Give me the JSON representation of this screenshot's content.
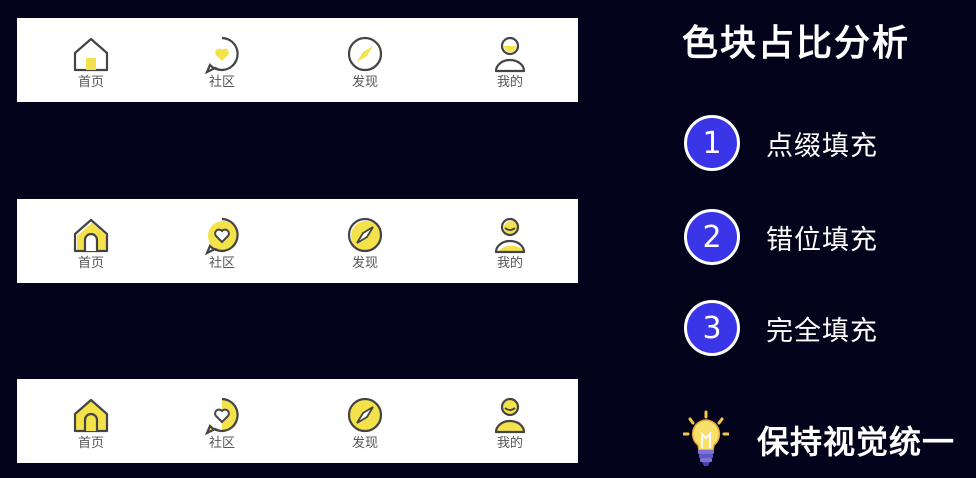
{
  "title": "色块占比分析",
  "tabs": [
    "首页",
    "社区",
    "发现",
    "我的"
  ],
  "items": [
    {
      "num": "1",
      "text": "点缀填充"
    },
    {
      "num": "2",
      "text": "错位填充"
    },
    {
      "num": "3",
      "text": "完全填充"
    }
  ],
  "tip": {
    "icon": "lightbulb-icon",
    "text": "保持视觉统一"
  },
  "colors": {
    "background": "#04031c",
    "accent_blue": "#3a35e6",
    "fill_yellow": "#f3e24a",
    "bar_white": "#ffffff"
  }
}
